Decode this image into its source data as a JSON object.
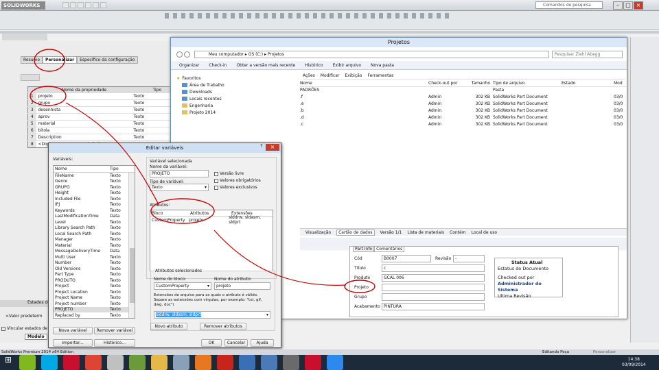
{
  "app": {
    "logo": "SOLIDWORKS",
    "search_placeholder": "Comandos de pesquisa",
    "status_left": "SolidWorks Premium 2014 x64 Edition",
    "status_mid": "Editando Peça",
    "status_right": "Personalizar"
  },
  "props": {
    "tabs": [
      "Resumo",
      "Personalizar",
      "Específico da configuração"
    ],
    "headers": [
      "Nome da propriedade",
      "Tipo"
    ],
    "rows": [
      {
        "n": "1",
        "name": "projeto",
        "type": "Texto"
      },
      {
        "n": "2",
        "name": "grupo",
        "type": "Texto"
      },
      {
        "n": "3",
        "name": "desenhista",
        "type": "Texto"
      },
      {
        "n": "4",
        "name": "aprov",
        "type": "Texto"
      },
      {
        "n": "5",
        "name": "material",
        "type": "Texto"
      },
      {
        "n": "6",
        "name": "bitola",
        "type": "Texto"
      },
      {
        "n": "7",
        "name": "Description",
        "type": "Texto"
      },
      {
        "n": "8",
        "name": "<Digite uma nova propriedade>",
        "type": ""
      }
    ]
  },
  "left_bottom": {
    "header": "Estados do",
    "value": "<Valor predeterm",
    "checkbox": "Vincular estados de exi",
    "tab": "Modelo"
  },
  "explorer": {
    "title": "Projetos",
    "breadcrumb": [
      "Meu computador",
      "OS (C:)",
      "Projetos"
    ],
    "search_placeholder": "Pesquisar Ziehl Abegg",
    "toolbar": [
      "Organizar",
      "Check-in",
      "Obter a versão mais recente",
      "Histórico",
      "Exibir arquivo",
      "Nova pasta"
    ],
    "actions": [
      "Ações",
      "Modificar",
      "Exibição",
      "Ferramentas"
    ],
    "nav": [
      "Favoritos",
      "Área de Trabalho",
      "Downloads",
      "Locais recentes",
      "Engenharia",
      "Projeto 2014"
    ],
    "columns": [
      "Nome",
      "Check-out por",
      "Tamanho",
      "Tipo de arquivo",
      "Estado",
      "Mod"
    ],
    "files": [
      {
        "name": "PADRÕES",
        "by": "",
        "size": "",
        "type": "Pasta",
        "mod": ""
      },
      {
        "name": ".f",
        "by": "Admin",
        "size": "302 KB",
        "type": "SolidWorks Part Document",
        "mod": "03/0"
      },
      {
        "name": ".e",
        "by": "Admin",
        "size": "302 KB",
        "type": "SolidWorks Part Document",
        "mod": "03/0"
      },
      {
        "name": ".b",
        "by": "Admin",
        "size": "302 KB",
        "type": "SolidWorks Part Document",
        "mod": "03/0"
      },
      {
        "name": ".d",
        "by": "Admin",
        "size": "302 KB",
        "type": "SolidWorks Part Document",
        "mod": "03/0"
      },
      {
        "name": ".c",
        "by": "Admin",
        "size": "302 KB",
        "type": "SolidWorks Part Document",
        "mod": "03/0"
      }
    ],
    "bottom_tabs": [
      "Visualização",
      "Cartão de dados",
      "Versão 1/1",
      "Lista de materiais",
      "Contém",
      "Local de uso"
    ],
    "card": {
      "tabs": [
        "Part Info",
        "Comentários"
      ],
      "cod_label": "Cód",
      "cod": "B0007",
      "rev_label": "Revisão",
      "rev": "-",
      "titulo_label": "Título",
      "titulo": "c",
      "produto_label": "Produto",
      "produto": "GCAL 006",
      "projeto_label": "Projeto",
      "grupo_label": "Grupo",
      "acab_label": "Acabamento",
      "acab": "PINTURA",
      "status_title": "Status Atual",
      "status_sub": "Estatus do Documento",
      "checked": "Checked out por",
      "admin": "Administrador do Sistema",
      "ultima": "Ultima Revisão"
    }
  },
  "dialog": {
    "title": "Editar variáveis",
    "vars_label": "Variáveis:",
    "col_name": "Nome",
    "col_type": "Tipo",
    "vars": [
      [
        "FileName",
        "Texto"
      ],
      [
        "Genre",
        "Texto"
      ],
      [
        "GRUPO",
        "Texto"
      ],
      [
        "Height",
        "Texto"
      ],
      [
        "Included File",
        "Texto"
      ],
      [
        "IPJ",
        "Texto"
      ],
      [
        "Keywords",
        "Texto"
      ],
      [
        "LastModificationTime",
        "Data"
      ],
      [
        "Level",
        "Texto"
      ],
      [
        "Library Search Path",
        "Texto"
      ],
      [
        "Local Search Path",
        "Texto"
      ],
      [
        "Manager",
        "Texto"
      ],
      [
        "Material",
        "Texto"
      ],
      [
        "MessageDeliveryTime",
        "Data"
      ],
      [
        "Multi User",
        "Texto"
      ],
      [
        "Number",
        "Texto"
      ],
      [
        "Old Versions",
        "Texto"
      ],
      [
        "Part Type",
        "Texto"
      ],
      [
        "PRODUTO",
        "Texto"
      ],
      [
        "Project",
        "Texto"
      ],
      [
        "Project Location",
        "Texto"
      ],
      [
        "Project Name",
        "Texto"
      ],
      [
        "Project number",
        "Texto"
      ],
      [
        "PROJETO",
        "Texto"
      ],
      [
        "Replaced by",
        "Texto"
      ]
    ],
    "new_var": "Nova variável",
    "remove_var": "Remover variável",
    "import": "Importar...",
    "history": "Histórico...",
    "selected_var": "Variável selecionada",
    "var_name_label": "Nome da variável:",
    "var_name": "PROJETO",
    "var_type_label": "Tipo de variável:",
    "var_type": "Texto",
    "chk_free": "Versão livre",
    "chk_required": "Valores obrigatórios",
    "chk_exclusive": "Valores exclusivos",
    "attrs_label": "Atributos:",
    "attr_cols": [
      "Bloco",
      "Atributos",
      "Extensões"
    ],
    "attr_row": [
      "CustomProperty",
      "projeto",
      "slddrw, sldasm, sldprt"
    ],
    "sel_attrs": "Atributos selecionados",
    "block_label": "Nome do bloco:",
    "block": "CustomProperty",
    "attr_label": "Nome do atributo:",
    "attr": "projeto",
    "ext_text": "Extensões de arquivo para as quais o atributo é válido. Separe as extensões com vírgulas, por exemplo: \"txt, gif, dwg, doc\")",
    "ext_value": "slddrw, sldasm, sldprt",
    "new_attr": "Novo atributo",
    "remove_attr": "Remover atributos",
    "ok": "OK",
    "cancel": "Cancelar",
    "help": "Ajuda"
  },
  "clock": {
    "time": "14:38",
    "date": "03/09/2014"
  },
  "colors": {
    "accent": "#cc0000",
    "selection": "#3399ff",
    "taskbar": "#1c2a3a"
  }
}
